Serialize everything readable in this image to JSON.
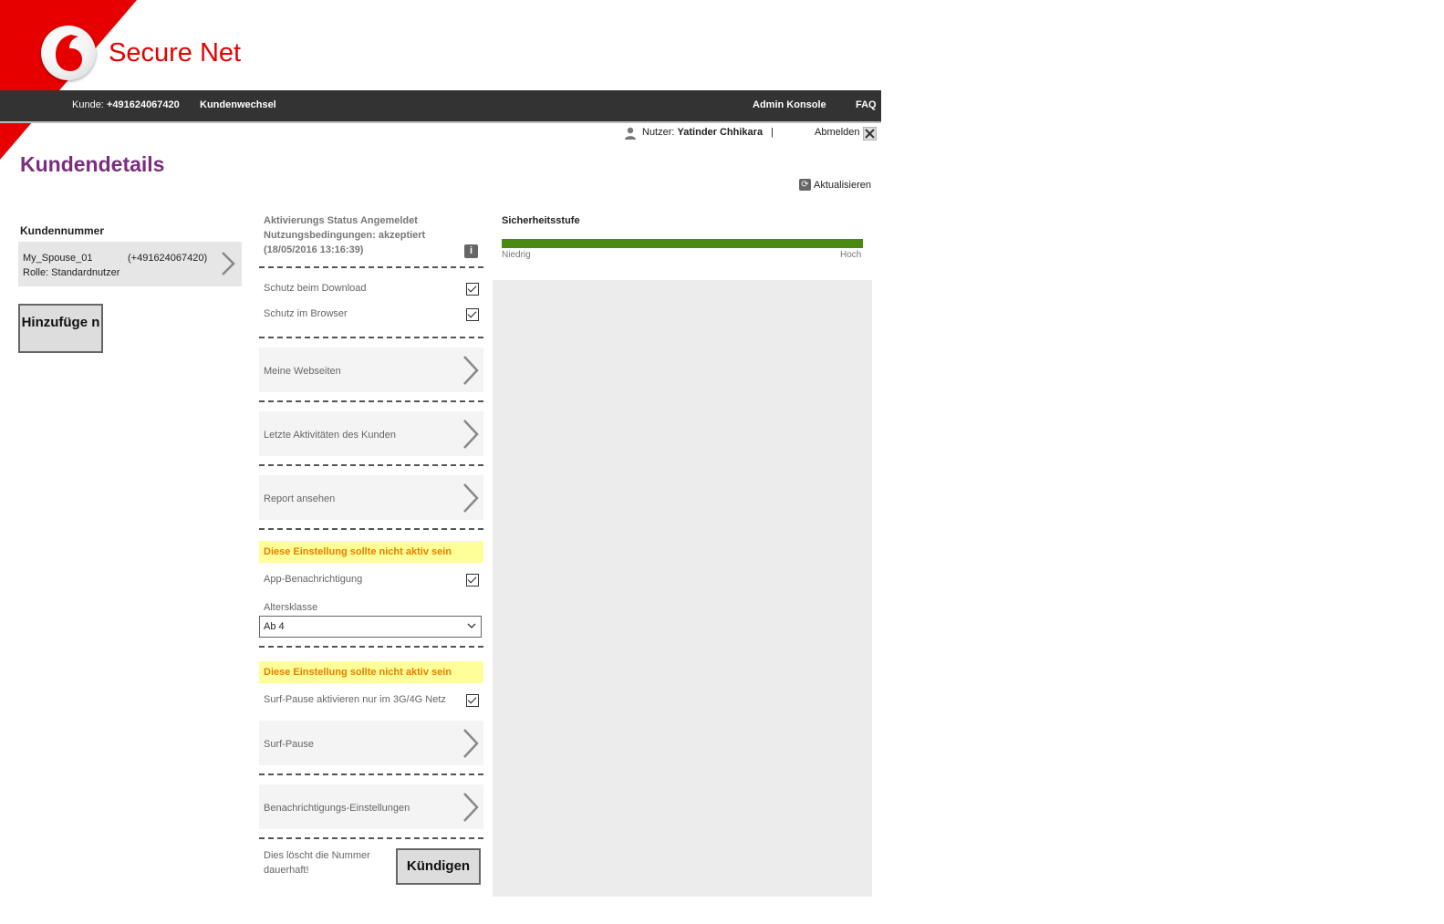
{
  "brand": {
    "name": "Secure Net",
    "accent": "#e60000",
    "title_color": "#7b2d7f"
  },
  "navbar": {
    "customer_label": "Kunde:",
    "customer_number": "+491624067420",
    "switch_customer": "Kundenwechsel",
    "admin_console": "Admin Konsole",
    "faq": "FAQ"
  },
  "userbar": {
    "user_label": "Nutzer:",
    "user_name": "Yatinder Chhikara",
    "separator": "|",
    "logout": "Abmelden"
  },
  "page": {
    "title": "Kundendetails",
    "refresh": "Aktualisieren"
  },
  "left": {
    "label": "Kundennummer",
    "customer": {
      "name": "My_Spouse_01",
      "number": "(+491624067420)",
      "role": "Rolle: Standardnutzer"
    },
    "add_button": "Hinzufüge n"
  },
  "middle": {
    "status_line1": "Aktivierungs Status Angemeldet",
    "status_line2": "Nutzungsbedingungen: akzeptiert",
    "status_line3": "(18/05/2016 13:16:39)",
    "download_protection": "Schutz beim Download",
    "browser_protection": "Schutz im Browser",
    "my_websites": "Meine Webseiten",
    "recent_activity": "Letzte Aktivitäten des Kunden",
    "view_report": "Report ansehen",
    "warning1": "Diese Einstellung sollte nicht aktiv sein",
    "app_notification": "App-Benachrichtigung",
    "age_class_label": "Altersklasse",
    "age_class_value": "Ab 4",
    "warning2": "Diese Einstellung sollte nicht aktiv sein",
    "surf_pause_3g": "Surf-Pause aktivieren nur im 3G/4G Netz",
    "surf_pause": "Surf-Pause",
    "notification_settings": "Benachrichtigungs-Einstellungen",
    "delete_note_line1": "Dies löscht die Nummer",
    "delete_note_line2": "dauerhaft!",
    "cancel_button": "Kündigen"
  },
  "security": {
    "label": "Sicherheitsstufe",
    "low": "Niedrig",
    "high": "Hoch",
    "level_fraction": 1.0,
    "bar_color": "#4a8a10"
  }
}
